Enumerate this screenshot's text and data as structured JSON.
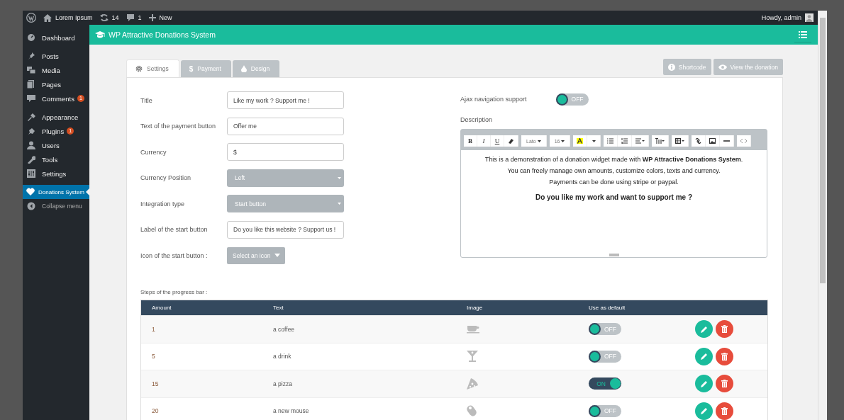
{
  "admin_bar": {
    "site": "Lorem Ipsum",
    "updates": "14",
    "comments": "1",
    "new": "New",
    "greeting": "Howdy, admin"
  },
  "sidebar": {
    "items": [
      {
        "label": "Dashboard",
        "selected": false
      },
      {
        "label": "Posts",
        "selected": false
      },
      {
        "label": "Media",
        "selected": false
      },
      {
        "label": "Pages",
        "selected": false
      },
      {
        "label": "Comments",
        "badge": "1",
        "selected": false
      },
      {
        "label": "Appearance",
        "selected": false
      },
      {
        "label": "Plugins",
        "badge": "1",
        "selected": false
      },
      {
        "label": "Users",
        "selected": false
      },
      {
        "label": "Tools",
        "selected": false
      },
      {
        "label": "Settings",
        "selected": false
      },
      {
        "label": "Donations System",
        "selected": true
      },
      {
        "label": "Collapse menu",
        "selected": false
      }
    ]
  },
  "header": {
    "title": "WP Attractive Donations System"
  },
  "tabs": [
    {
      "label": "Settings",
      "selected": true
    },
    {
      "label": "Payment",
      "glyph": "$",
      "selected": false
    },
    {
      "label": "Design",
      "selected": false
    }
  ],
  "actions": [
    "Shortcode",
    "View the donation"
  ],
  "fields": [
    {
      "label": "Title",
      "kind": "text",
      "value": "Like my work ? Support me !"
    },
    {
      "label": "Text of the payment button",
      "kind": "text",
      "value": "Offer me"
    },
    {
      "label": "Currency",
      "kind": "text",
      "value": "$"
    },
    {
      "label": "Currency Position",
      "kind": "select",
      "value": "Left"
    },
    {
      "label": "Integration type",
      "kind": "select",
      "value": "Start button"
    },
    {
      "label": "Label of the start button",
      "kind": "text",
      "value": "Do you like this website ? Support us !"
    },
    {
      "label": "Icon of the start button :",
      "kind": "picker",
      "value": "Select an icon"
    }
  ],
  "ajax": {
    "label": "Ajax navigation support",
    "on": false,
    "toggle_label": "OFF"
  },
  "description": {
    "label": "Description",
    "toolbar": {
      "bold": "B",
      "italic": "I",
      "underline": "U",
      "font": "Lato",
      "size": "16"
    },
    "paragraphs": [
      {
        "text": "This is a demonstration of a donation widget made with **WP Attractive Donations System**.",
        "bold": false
      },
      {
        "text": "You can freely manage own amounts, customize colors, texts and currency.",
        "bold": false
      },
      {
        "text": "Payments can be done using stripe or paypal.",
        "bold": false
      },
      {
        "text": "Do you like my work and want to support me ?",
        "bold": true
      }
    ]
  },
  "steps": {
    "label": "Steps of the progress bar :",
    "columns": [
      "Amount",
      "Text",
      "Image",
      "Use as default"
    ],
    "rows": [
      {
        "amount": "1",
        "text": "a coffee",
        "default": false,
        "toggle_label": "OFF"
      },
      {
        "amount": "5",
        "text": "a drink",
        "default": false,
        "toggle_label": "OFF"
      },
      {
        "amount": "15",
        "text": "a pizza",
        "default": true,
        "toggle_label": "ON"
      },
      {
        "amount": "20",
        "text": "a new mouse",
        "default": false,
        "toggle_label": "OFF"
      }
    ]
  }
}
